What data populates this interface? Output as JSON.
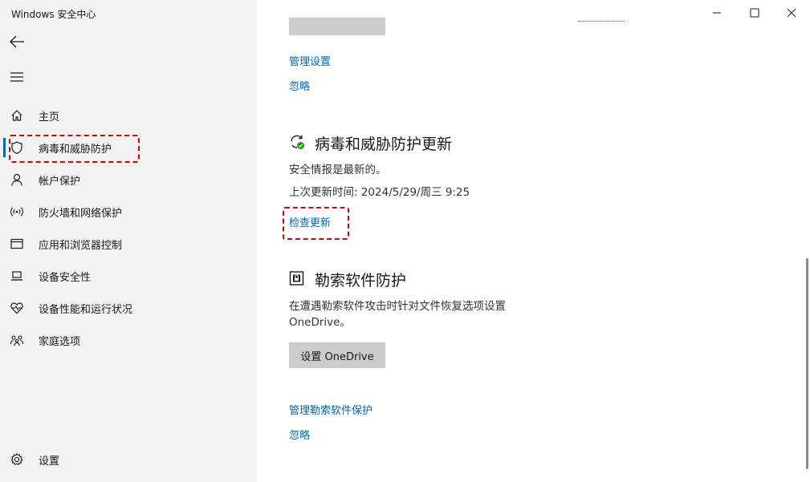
{
  "window": {
    "title": "Windows 安全中心"
  },
  "sidebar": {
    "items": [
      {
        "label": "主页",
        "icon": "home-icon"
      },
      {
        "label": "病毒和威胁防护",
        "icon": "shield-icon",
        "active": true
      },
      {
        "label": "帐户保护",
        "icon": "person-icon"
      },
      {
        "label": "防火墙和网络保护",
        "icon": "wifi-icon"
      },
      {
        "label": "应用和浏览器控制",
        "icon": "app-window-icon"
      },
      {
        "label": "设备安全性",
        "icon": "laptop-icon"
      },
      {
        "label": "设备性能和运行状况",
        "icon": "heart-icon"
      },
      {
        "label": "家庭选项",
        "icon": "family-icon"
      }
    ],
    "settings_label": "设置"
  },
  "main": {
    "top_links": {
      "manage": "管理设置",
      "dismiss": "忽略"
    },
    "updates": {
      "title": "病毒和威胁防护更新",
      "status": "安全情报是最新的。",
      "last_update": "上次更新时间: 2024/5/29/周三 9:25",
      "check_link": "检查更新"
    },
    "ransomware": {
      "title": "勒索软件防护",
      "description_line1": "在遭遇勒索软件攻击时针对文件恢复选项设置",
      "description_line2": "OneDrive。",
      "setup_button": "设置 OneDrive",
      "manage_link": "管理勒索软件保护",
      "dismiss_link": "忽略"
    }
  },
  "colors": {
    "accent": "#0067c0",
    "highlight": "#e00000",
    "sidebar_bg": "#f2f2f2"
  }
}
